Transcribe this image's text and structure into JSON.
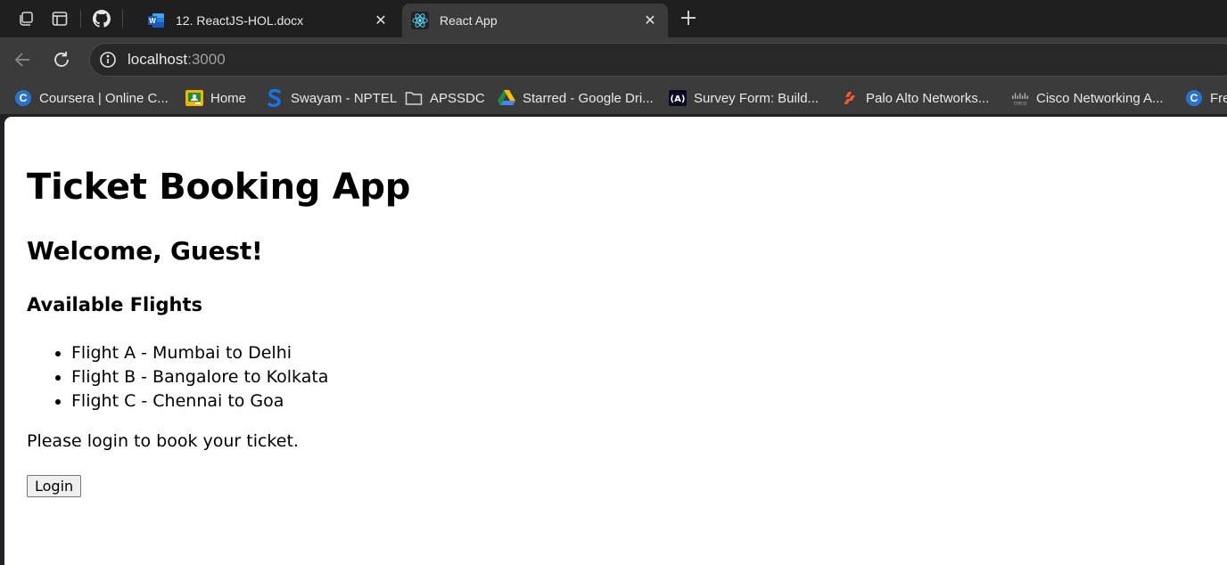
{
  "browser": {
    "tabs": [
      {
        "title": "12. ReactJS-HOL.docx",
        "favicon": "word-icon",
        "active": false
      },
      {
        "title": "React App",
        "favicon": "react-icon",
        "active": true
      }
    ],
    "address_bar": {
      "host": "localhost",
      "port": ":3000"
    },
    "bookmarks": [
      {
        "label": "Coursera | Online C...",
        "icon": "coursera-icon"
      },
      {
        "label": "Home",
        "icon": "classroom-icon"
      },
      {
        "label": "Swayam - NPTEL",
        "icon": "swayam-icon"
      },
      {
        "label": "APSSDC",
        "icon": "folder-icon"
      },
      {
        "label": "Starred - Google Dri...",
        "icon": "google-drive-icon"
      },
      {
        "label": "Survey Form: Build...",
        "icon": "freecodecamp-icon"
      },
      {
        "label": "Palo Alto Networks...",
        "icon": "paloalto-icon"
      },
      {
        "label": "Cisco Networking A...",
        "icon": "cisco-icon"
      },
      {
        "label": "Fre",
        "icon": "coursera-icon"
      }
    ]
  },
  "app": {
    "title": "Ticket Booking App",
    "welcome": "Welcome, Guest!",
    "flights_heading": "Available Flights",
    "flights": [
      "Flight A - Mumbai to Delhi",
      "Flight B - Bangalore to Kolkata",
      "Flight C - Chennai to Goa"
    ],
    "login_prompt": "Please login to book your ticket.",
    "login_button": "Login"
  }
}
